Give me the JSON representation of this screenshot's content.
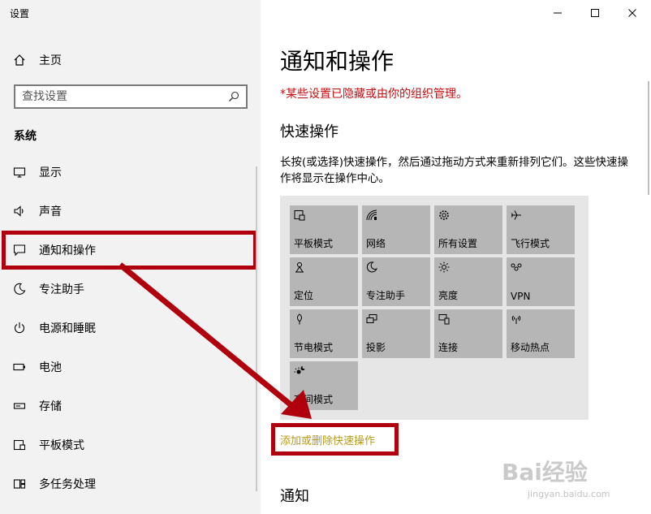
{
  "window": {
    "app_title": "设置"
  },
  "sidebar": {
    "home_label": "主页",
    "search_placeholder": "查找设置",
    "section_label": "系统",
    "items": [
      {
        "label": "显示",
        "icon": "monitor-icon"
      },
      {
        "label": "声音",
        "icon": "speaker-icon"
      },
      {
        "label": "通知和操作",
        "icon": "message-icon"
      },
      {
        "label": "专注助手",
        "icon": "moon-icon"
      },
      {
        "label": "电源和睡眠",
        "icon": "power-icon"
      },
      {
        "label": "电池",
        "icon": "battery-icon"
      },
      {
        "label": "存储",
        "icon": "storage-icon"
      },
      {
        "label": "平板模式",
        "icon": "tablet-icon"
      },
      {
        "label": "多任务处理",
        "icon": "multitask-icon"
      }
    ]
  },
  "main": {
    "title": "通知和操作",
    "managed_notice": "*某些设置已隐藏或由你的组织管理。",
    "quick_actions_heading": "快速操作",
    "quick_actions_desc": "长按(或选择)快速操作，然后通过拖动方式来重新排列它们。这些快速操作将显示在操作中心。",
    "tiles": [
      {
        "label": "平板模式",
        "icon": "tablet-mode-icon"
      },
      {
        "label": "网络",
        "icon": "network-icon"
      },
      {
        "label": "所有设置",
        "icon": "gear-icon"
      },
      {
        "label": "飞行模式",
        "icon": "airplane-icon"
      },
      {
        "label": "定位",
        "icon": "location-icon"
      },
      {
        "label": "专注助手",
        "icon": "moon-icon"
      },
      {
        "label": "亮度",
        "icon": "brightness-icon"
      },
      {
        "label": "VPN",
        "icon": "vpn-icon"
      },
      {
        "label": "节电模式",
        "icon": "battery-saver-icon"
      },
      {
        "label": "投影",
        "icon": "project-icon"
      },
      {
        "label": "连接",
        "icon": "connect-icon"
      },
      {
        "label": "移动热点",
        "icon": "hotspot-icon"
      },
      {
        "label": "夜间模式",
        "icon": "night-light-icon"
      }
    ],
    "add_remove_link": "添加或删除快速操作",
    "notifications_heading": "通知"
  },
  "colors": {
    "highlight": "#b0000d",
    "link": "#b69a1a",
    "managed": "#c50d10"
  }
}
